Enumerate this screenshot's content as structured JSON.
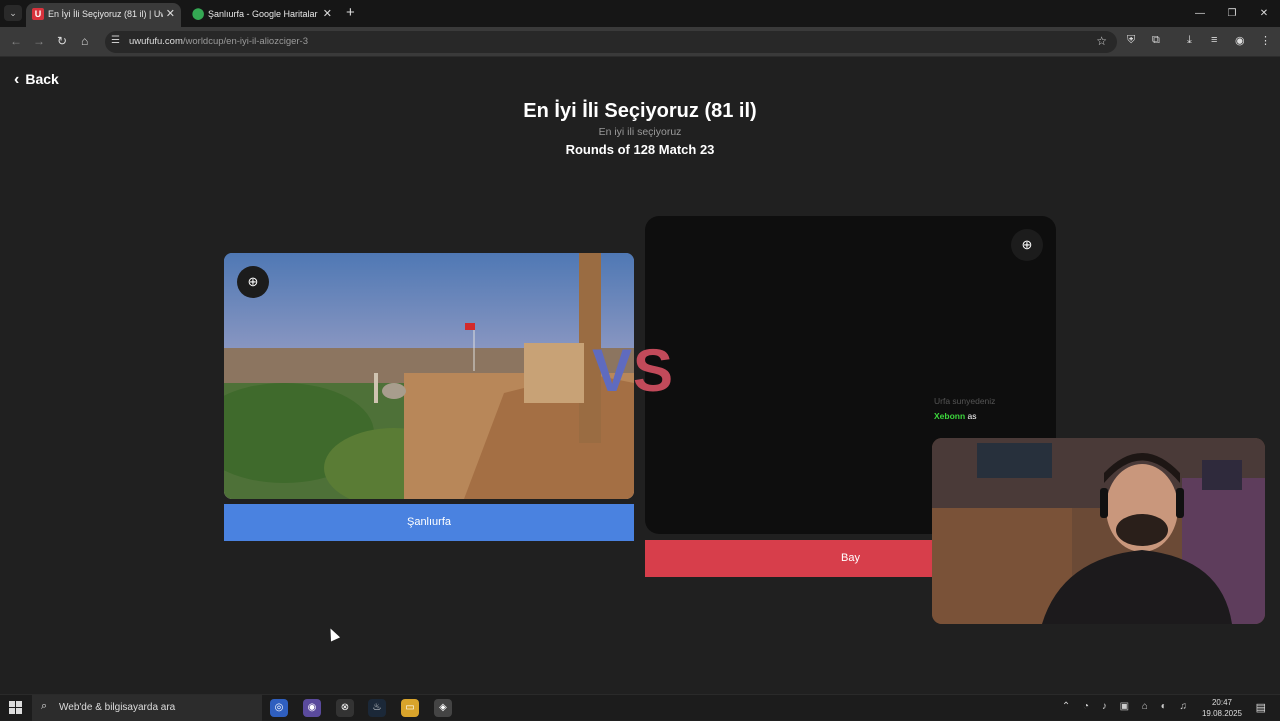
{
  "browser": {
    "tabs": [
      {
        "title": "En İyi İli Seçiyoruz (81 il) | UwU",
        "favicon": "U",
        "active": true
      },
      {
        "title": "Şanlıurfa - Google Haritalar",
        "favicon": "maps-pin",
        "active": false
      }
    ],
    "new_tab": "+",
    "window_controls": {
      "minimize": "—",
      "restore": "❐",
      "close": "✕"
    },
    "address": {
      "domain": "uwufufu.com",
      "path": "/worldcup/en-iyi-il-aliozciger-3"
    }
  },
  "page": {
    "back_label": "Back",
    "title": "En İyi İli Seçiyoruz (81 il)",
    "subtitle": "En iyi ili seçiyoruz",
    "round_info": "Rounds of 128 Match 23",
    "vs_v": "V",
    "vs_s": "S",
    "left_choice": {
      "label": "Şanlıurfa",
      "button_color": "#4a82e0"
    },
    "right_choice": {
      "label": "Bay",
      "button_color": "#d73e4b"
    }
  },
  "overlay": {
    "chat": [
      {
        "user": "",
        "message": "Urfa sunyedeniz",
        "faded": true
      },
      {
        "user": "Xebonn",
        "message": "as",
        "faded": false
      }
    ]
  },
  "taskbar": {
    "search_placeholder": "Web'de & bilgisayarda ara",
    "time": "20:47",
    "date": "19.08.2025"
  }
}
